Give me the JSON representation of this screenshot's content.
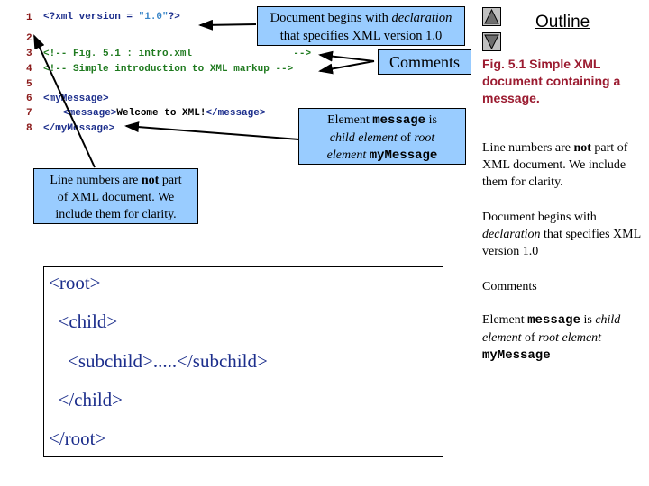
{
  "code": {
    "line_numbers": [
      "1",
      "2",
      "3",
      "4",
      "5",
      "6",
      "7",
      "8"
    ],
    "line1": {
      "open": "<?xml version = ",
      "value": "\"1.0\"",
      "close": "?>"
    },
    "line3": "<!-- Fig. 5.1 : intro.xml                 -->",
    "line4": "<!-- Simple introduction to XML markup -->",
    "line6": "<myMessage>",
    "line7": {
      "open_tag": "<message>",
      "text": "Welcome to XML!",
      "close_tag": "</message>"
    },
    "line8": "</myMessage>"
  },
  "callouts": {
    "declaration": {
      "pre": "Document begins with ",
      "em": "declaration",
      "post": "that specifies XML version 1.0"
    },
    "comments": "Comments",
    "element": {
      "pre": "Element ",
      "code1": "message",
      "mid": " is",
      "em1": "child element",
      "mid2": " of ",
      "em2": "root",
      "em3": "element ",
      "code2": "myMessage"
    },
    "line_numbers": {
      "pre": "Line numbers are ",
      "strong": "not",
      "post": " part",
      "line2": "of XML document. We",
      "line3": "include them for clarity."
    }
  },
  "tree": {
    "lines": [
      "<root>",
      "  <child>",
      "    <subchild>.....</subchild>",
      "  </child>",
      "</root>"
    ]
  },
  "sidebar": {
    "nav_up": "up-arrow",
    "nav_down": "down-arrow",
    "outline_title": "Outline",
    "figure_caption": "Fig. 5.1    Simple XML document containing a message.",
    "notes": {
      "line_numbers": {
        "pre": "Line numbers are ",
        "strong": "not",
        "post": " part of XML document. We include them for clarity."
      },
      "declaration": {
        "pre": "Document begins with ",
        "em": "declaration",
        "post": " that specifies XML version 1.0"
      },
      "comments": "Comments",
      "element": {
        "pre": "Element ",
        "code1": "message",
        "mid": " is ",
        "em1": "child element",
        "mid2": " of ",
        "em2": "root element",
        "code2": "myMessage"
      }
    }
  },
  "colors": {
    "callout_bg": "#99ccff",
    "caption": "#9b1b30",
    "tag": "#1c2e8c",
    "comment": "#1f7a1f",
    "line_number": "#8b1a1a"
  }
}
